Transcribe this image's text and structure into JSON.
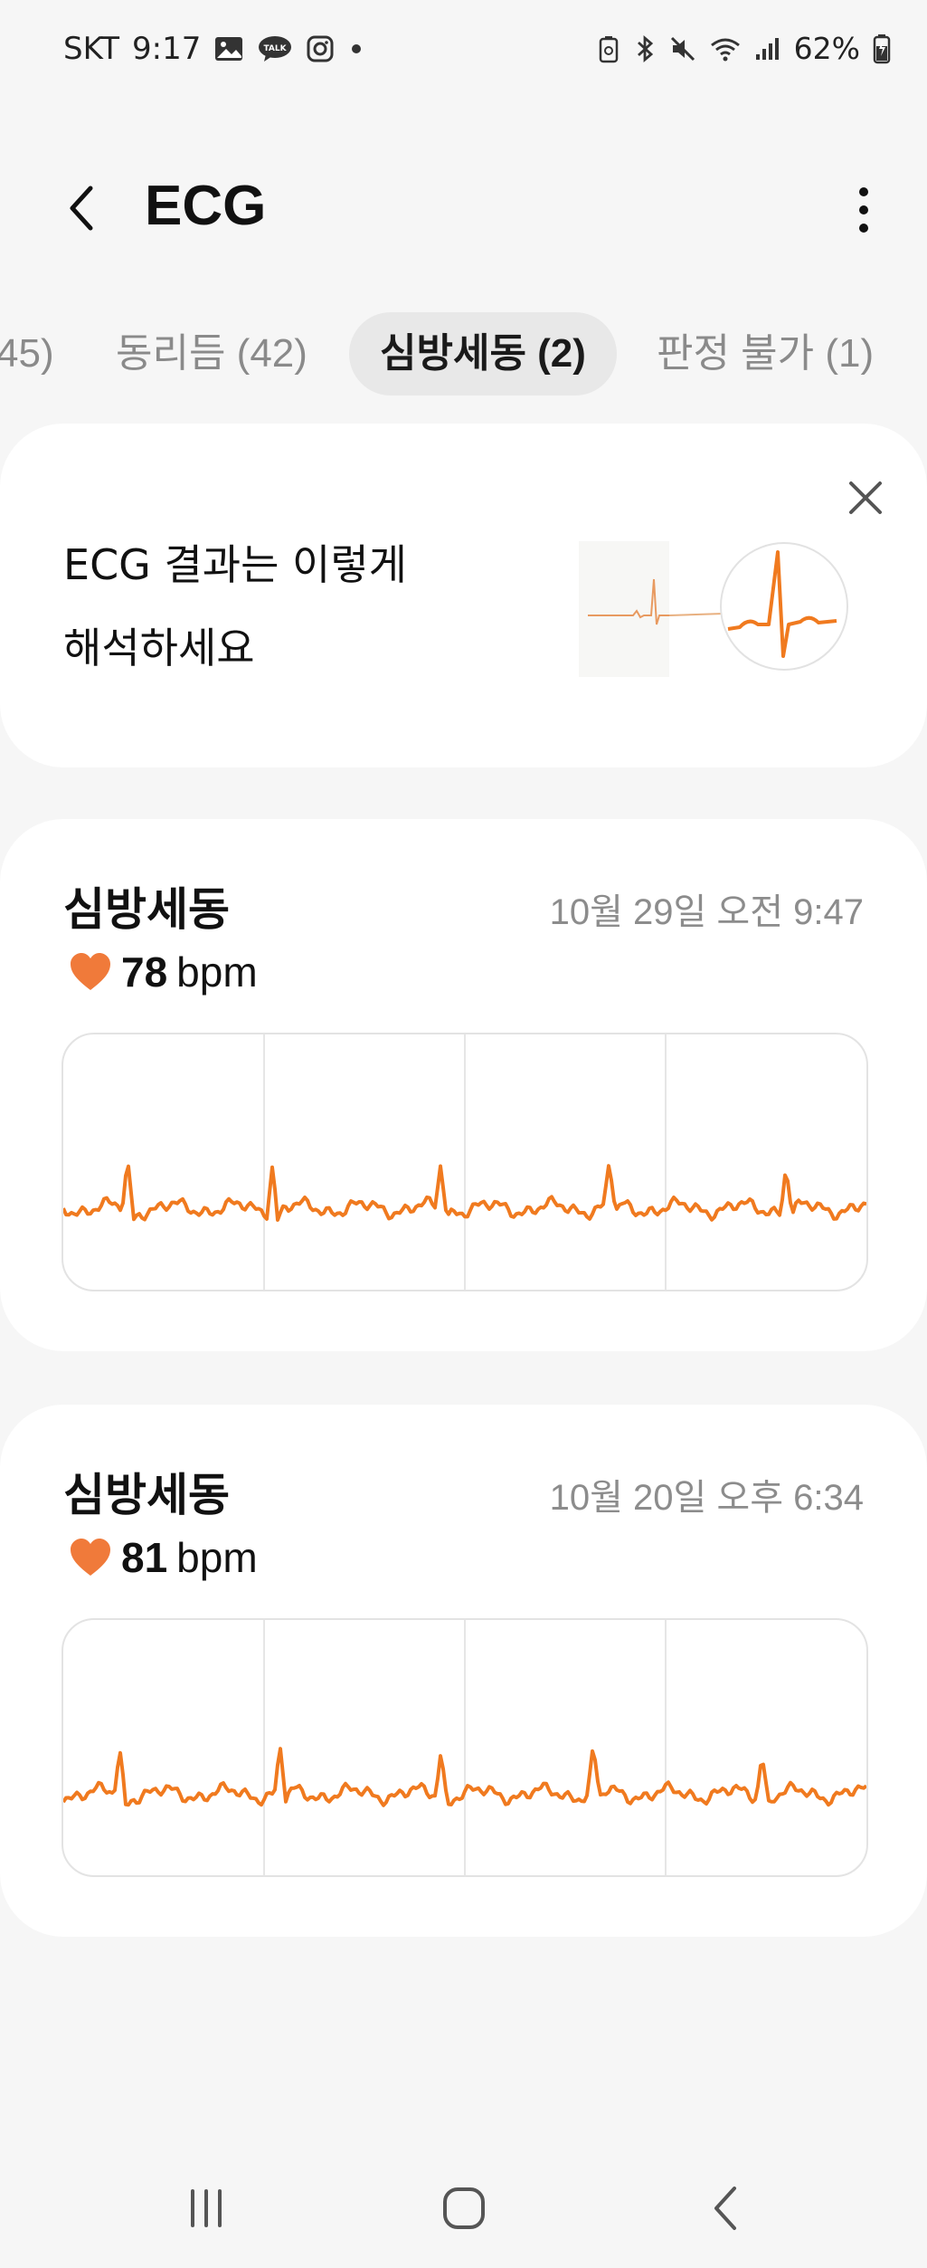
{
  "status_bar": {
    "carrier": "SKT",
    "time": "9:17",
    "battery": "62%"
  },
  "header": {
    "title": "ECG"
  },
  "tabs": [
    {
      "label": "45)"
    },
    {
      "label": "동리듬 (42)"
    },
    {
      "label": "심방세동 (2)",
      "active": true
    },
    {
      "label": "판정 불가 (1)"
    }
  ],
  "info_card": {
    "line1": "ECG 결과는 이렇게",
    "line2": "해석하세요"
  },
  "records": [
    {
      "title": "심방세동",
      "datetime": "10월 29일 오전 9:47",
      "bpm_value": "78",
      "bpm_unit": "bpm",
      "beats": [
        0.08,
        0.26,
        0.47,
        0.68,
        0.9
      ],
      "phase": 0
    },
    {
      "title": "심방세동",
      "datetime": "10월 20일 오후 6:34",
      "bpm_value": "81",
      "bpm_unit": "bpm",
      "beats": [
        0.07,
        0.27,
        0.47,
        0.66,
        0.87
      ],
      "phase": 1
    }
  ],
  "colors": {
    "accent_orange": "#f07a1f",
    "heart": "#f07a3a",
    "background": "#f6f6f6",
    "card": "#ffffff"
  }
}
